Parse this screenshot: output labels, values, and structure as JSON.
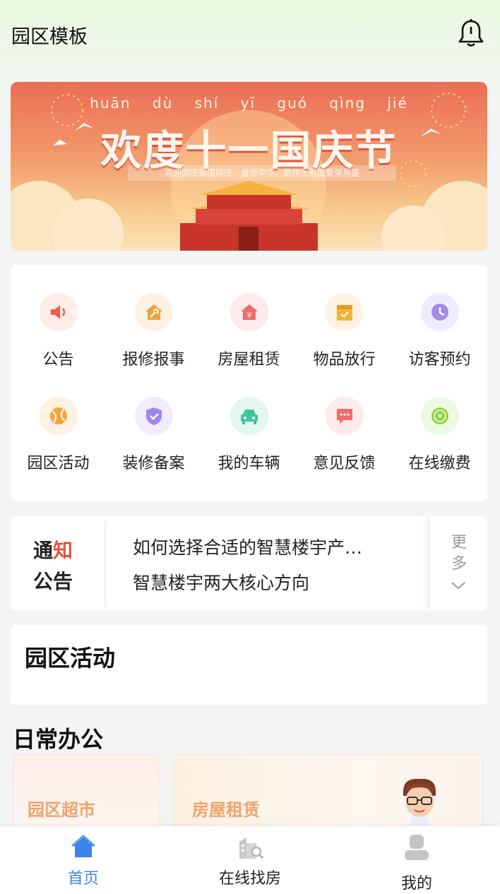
{
  "header": {
    "title": "园区模板",
    "bell_icon": "bell-icon"
  },
  "banner": {
    "pinyin": "huān dù shí yī guó qìng jié",
    "headline": "欢度十一国庆节",
    "subtitle": "喜迎国庆举国同庆，盛世中华，愿伟大祖国繁荣昌盛",
    "colors": {
      "top": "#ec6d55",
      "bottom": "#fbe3ba"
    }
  },
  "services": [
    {
      "label": "公告",
      "icon": "speaker-icon",
      "color": "#f05a4f",
      "bg": "#fdecea"
    },
    {
      "label": "报修报事",
      "icon": "wrench-house-icon",
      "color": "#f0a13c",
      "bg": "#fdf1e2"
    },
    {
      "label": "房屋租赁",
      "icon": "house-yen-icon",
      "color": "#f06b6b",
      "bg": "#fdeaea"
    },
    {
      "label": "物品放行",
      "icon": "box-icon",
      "color": "#f3b23a",
      "bg": "#fdf3e2"
    },
    {
      "label": "访客预约",
      "icon": "clock-icon",
      "color": "#a28bea",
      "bg": "#f0ecfc"
    },
    {
      "label": "园区活动",
      "icon": "ball-icon",
      "color": "#f2a63c",
      "bg": "#fdf1e2"
    },
    {
      "label": "装修备案",
      "icon": "shield-icon",
      "color": "#9d86ee",
      "bg": "#f0ecfc"
    },
    {
      "label": "我的车辆",
      "icon": "car-icon",
      "color": "#3fc59a",
      "bg": "#e4f7ef"
    },
    {
      "label": "意见反馈",
      "icon": "chat-icon",
      "color": "#f06b6b",
      "bg": "#fdeaea"
    },
    {
      "label": "在线缴费",
      "icon": "coin-icon",
      "color": "#8fd33f",
      "bg": "#eef9e2"
    }
  ],
  "notice": {
    "tag_line1_a": "通",
    "tag_line1_b": "知",
    "tag_line2": "公告",
    "items": [
      "如何选择合适的智慧楼宇产…",
      "智慧楼宇两大核心方向"
    ],
    "more_label": "更多"
  },
  "activity": {
    "title": "园区活动"
  },
  "office": {
    "title": "日常办公",
    "cards": [
      {
        "label": "园区超市"
      },
      {
        "label": "房屋租赁"
      }
    ]
  },
  "tabbar": {
    "active_color": "#3d84e8",
    "items": [
      {
        "label": "首页",
        "icon": "home-icon",
        "active": true
      },
      {
        "label": "在线找房",
        "icon": "building-search-icon",
        "active": false
      },
      {
        "label": "我的",
        "icon": "user-icon",
        "active": false
      }
    ]
  }
}
